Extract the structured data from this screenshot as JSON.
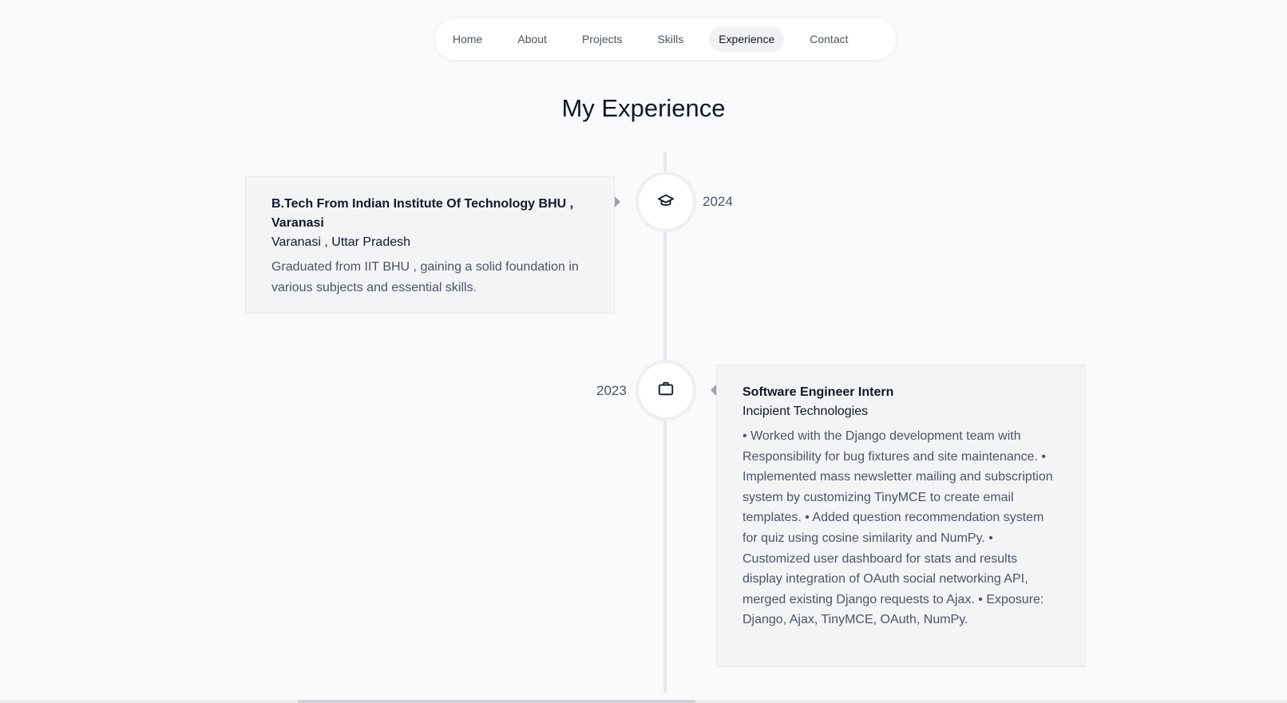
{
  "nav": {
    "items": [
      {
        "label": "Home"
      },
      {
        "label": "About"
      },
      {
        "label": "Projects"
      },
      {
        "label": "Skills"
      },
      {
        "label": "Experience",
        "active": true
      },
      {
        "label": "Contact"
      }
    ]
  },
  "page": {
    "title": "My Experience"
  },
  "timeline": [
    {
      "icon": "graduation-cap-icon",
      "date": "2024",
      "title": "B.Tech From Indian Institute Of Technology BHU , Varanasi",
      "subtitle": "Varanasi , Uttar Pradesh",
      "description": "Graduated from IIT BHU , gaining a solid foundation in various subjects and essential skills."
    },
    {
      "icon": "briefcase-icon",
      "date": "2023",
      "title": "Software Engineer Intern",
      "subtitle": "Incipient Technologies",
      "description": "• Worked with the Django development team with Responsibility for bug fixtures and site maintenance. • Implemented mass newsletter mailing and subscription system by customizing TinyMCE to create email templates. • Added question recommendation system for quiz using cosine similarity and NumPy. • Customized user dashboard for stats and results display integration of OAuth social networking API, merged existing Django requests to Ajax. • Exposure: Django, Ajax, TinyMCE, OAuth, NumPy."
    }
  ],
  "colors": {
    "background": "#f9fafb",
    "card": "#f3f4f6",
    "line": "#e5e7eb",
    "text": "#111827",
    "muted": "#4b5563"
  }
}
